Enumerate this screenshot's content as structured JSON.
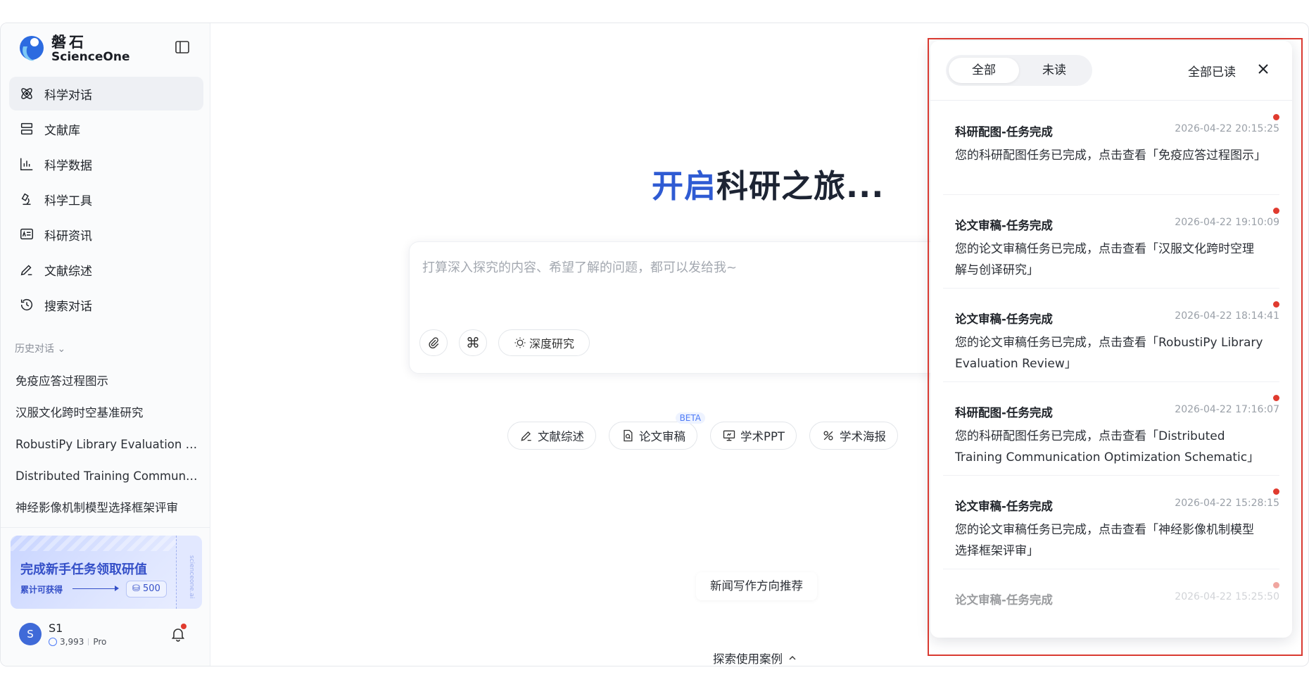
{
  "brand": {
    "cn": "磐石",
    "en": "ScienceOne"
  },
  "nav": [
    {
      "label": "科学对话",
      "icon": "atom-icon",
      "active": true
    },
    {
      "label": "文献库",
      "icon": "library-icon"
    },
    {
      "label": "科学数据",
      "icon": "data-chart-icon"
    },
    {
      "label": "科学工具",
      "icon": "microscope-icon"
    },
    {
      "label": "科研资讯",
      "icon": "news-icon"
    },
    {
      "label": "文献综述",
      "icon": "pen-icon"
    },
    {
      "label": "搜索对话",
      "icon": "history-icon"
    }
  ],
  "history": {
    "title": "历史对话",
    "items": [
      "免疫应答过程图示",
      "汉服文化跨时空基准研究",
      "RobustiPy Library Evaluation Re...",
      "Distributed Training Communic...",
      "神经影像机制模型选择框架评审"
    ]
  },
  "promo": {
    "title": "完成新手任务领取研值",
    "sub": "累计可获得",
    "badge": "500",
    "side_text": "scienceone.ai"
  },
  "user": {
    "initial": "S",
    "name": "S1",
    "credits": "3,993",
    "plan": "Pro"
  },
  "main": {
    "hero_accent": "开启",
    "hero_rest": "科研之旅...",
    "placeholder": "打算深入探究的内容、希望了解的问题，都可以发给我~",
    "deep_research": "深度研究",
    "chips": [
      {
        "label": "文献综述",
        "icon": "pen-icon"
      },
      {
        "label": "论文审稿",
        "icon": "doc-search-icon",
        "badge": "BETA"
      },
      {
        "label": "学术PPT",
        "icon": "presentation-icon"
      },
      {
        "label": "学术海报",
        "icon": "poster-icon"
      }
    ],
    "recommend": "新闻写作方向推荐",
    "explore": "探索使用案例"
  },
  "notifications": {
    "tab_all": "全部",
    "tab_unread": "未读",
    "mark_all_read": "全部已读",
    "items": [
      {
        "title": "科研配图-任务完成",
        "time": "2026-04-22 20:15:25",
        "body": "您的科研配图任务已完成，点击查看「免疫应答过程图示」"
      },
      {
        "title": "论文审稿-任务完成",
        "time": "2026-04-22 19:10:09",
        "body": "您的论文审稿任务已完成，点击查看「汉服文化跨时空理解与创译研究」"
      },
      {
        "title": "论文审稿-任务完成",
        "time": "2026-04-22 18:14:41",
        "body": "您的论文审稿任务已完成，点击查看「RobustiPy Library Evaluation Review」"
      },
      {
        "title": "科研配图-任务完成",
        "time": "2026-04-22 17:16:07",
        "body": "您的科研配图任务已完成，点击查看「Distributed Training Communication Optimization Schematic」"
      },
      {
        "title": "论文审稿-任务完成",
        "time": "2026-04-22 15:28:15",
        "body": "您的论文审稿任务已完成，点击查看「神经影像机制模型选择框架评审」"
      },
      {
        "title": "论文审稿-任务完成",
        "time": "2026-04-22 15:25:50",
        "body": ""
      }
    ]
  },
  "colors": {
    "accent": "#2f5bd3",
    "unread_dot": "#e03b2f",
    "highlight_border": "#d93a31"
  }
}
